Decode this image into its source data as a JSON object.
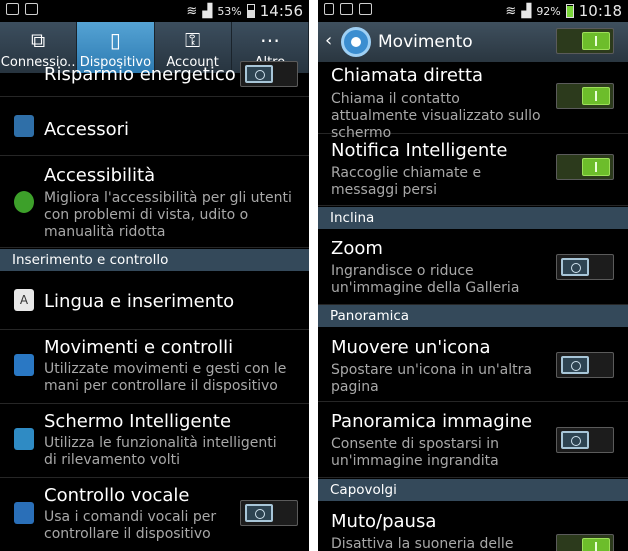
{
  "left": {
    "status": {
      "time": "14:56",
      "battery_pct": "53%"
    },
    "tabs": [
      {
        "label": "Connessio..",
        "icon": "connections-icon"
      },
      {
        "label": "Dispositivo",
        "icon": "device-icon"
      },
      {
        "label": "Account",
        "icon": "key-icon"
      },
      {
        "label": "Altro",
        "icon": "more-icon"
      }
    ],
    "partial_item": {
      "title": "Risparmio energetico",
      "toggle": "off"
    },
    "items": [
      {
        "title": "Accessori"
      },
      {
        "title": "Accessibilità",
        "desc": "Migliora l'accessibilità per gli utenti con problemi di vista, udito o manualità ridotta"
      }
    ],
    "section": "Inserimento e controllo",
    "items2": [
      {
        "title": "Lingua e inserimento"
      },
      {
        "title": "Movimenti e controlli",
        "desc": "Utilizzate movimenti e gesti con le mani per controllare il dispositivo"
      },
      {
        "title": "Schermo Intelligente",
        "desc": "Utilizza le funzionalità intelligenti di rilevamento volti"
      },
      {
        "title": "Controllo vocale",
        "desc": "Usa i comandi vocali per controllare il dispositivo",
        "toggle": "off"
      }
    ]
  },
  "right": {
    "status": {
      "time": "10:18",
      "battery_pct": "92%"
    },
    "header": {
      "title": "Movimento",
      "toggle": "on"
    },
    "items": [
      {
        "title": "Chiamata diretta",
        "desc": "Chiama il contatto attualmente visualizzato sullo schermo",
        "toggle": "on"
      },
      {
        "title": "Notifica Intelligente",
        "desc": "Raccoglie chiamate e messaggi persi",
        "toggle": "on"
      }
    ],
    "section1": "Inclina",
    "items2": [
      {
        "title": "Zoom",
        "desc": "Ingrandisce o riduce un'immagine della Galleria",
        "toggle": "off"
      }
    ],
    "section2": "Panoramica",
    "items3": [
      {
        "title": "Muovere un'icona",
        "desc": "Spostare un'icona in un'altra pagina",
        "toggle": "off"
      },
      {
        "title": "Panoramica immagine",
        "desc": "Consente di spostarsi in un'immagine ingrandita",
        "toggle": "off"
      }
    ],
    "section3": "Capovolgi",
    "items4": [
      {
        "title": "Muto/pausa",
        "desc": "Disattiva la suoneria delle",
        "toggle": "on"
      }
    ]
  }
}
